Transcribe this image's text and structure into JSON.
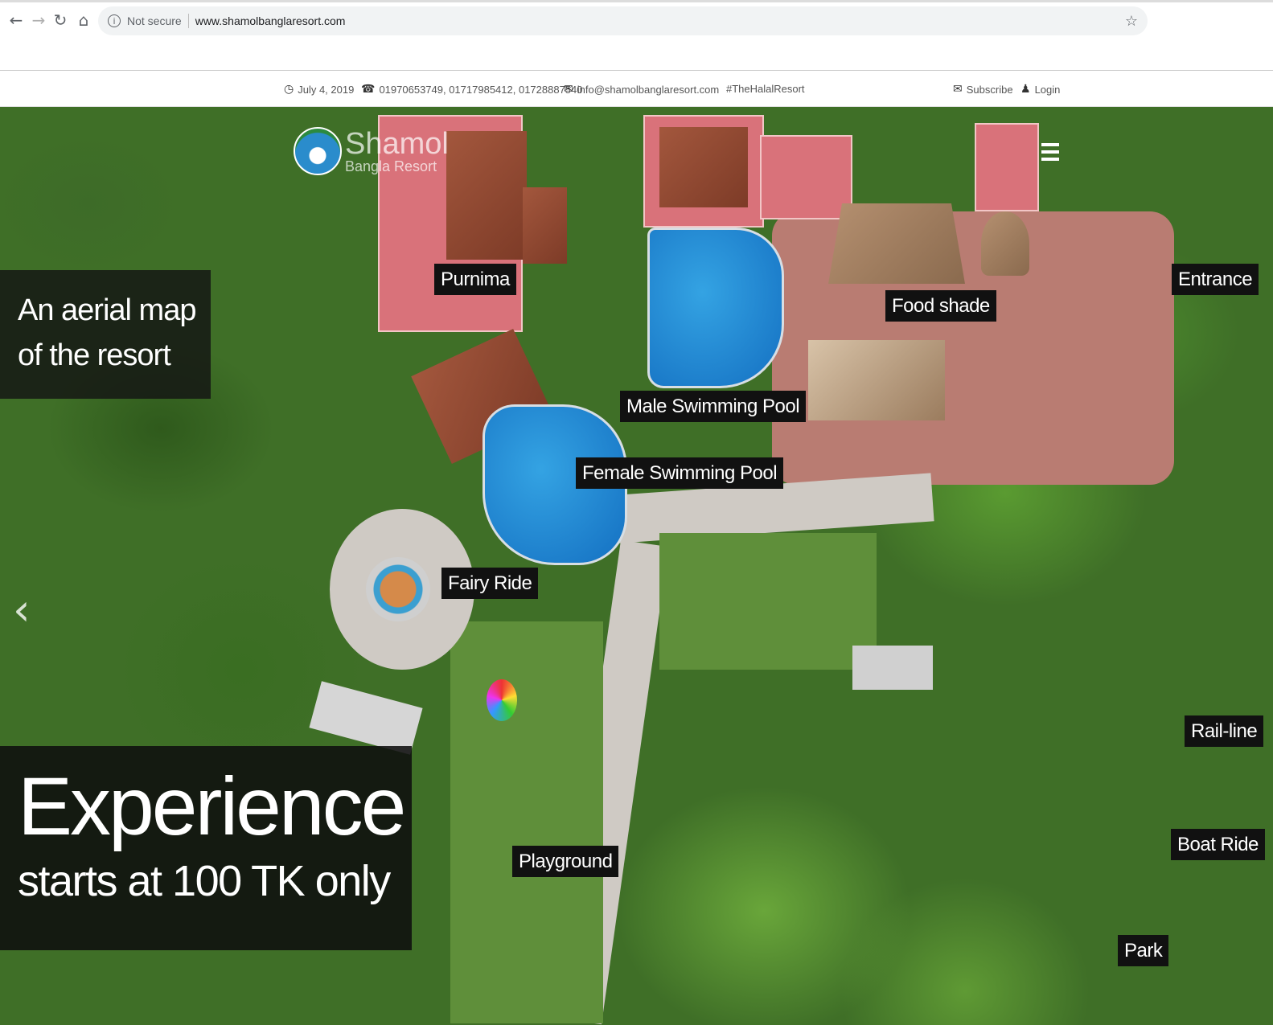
{
  "browser": {
    "security_label": "Not secure",
    "url": "www.shamolbanglaresort.com",
    "icons": [
      "back-arrow-icon",
      "forward-arrow-icon",
      "reload-icon",
      "home-icon",
      "info-icon",
      "star-icon"
    ]
  },
  "infobar": {
    "date": "July 4, 2019",
    "phones": "01970653749, 01717985412, 01728887540",
    "email": "info@shamolbanglaresort.com",
    "hashtag": "#TheHalalResort",
    "subscribe": "Subscribe",
    "login": "Login"
  },
  "logo": {
    "line1": "Shamol",
    "line2": "Bangla Resort"
  },
  "hero": {
    "caption_top_line1": "An aerial map",
    "caption_top_line2": "of the resort",
    "caption_big": "Experience",
    "caption_small": "starts at 100 TK only",
    "labels": {
      "purnima": "Purnima",
      "food_shade": "Food shade",
      "entrance": "Entrance",
      "male_pool": "Male Swimming Pool",
      "female_pool": "Female Swimming Pool",
      "fairy_ride": "Fairy Ride",
      "playground": "Playground",
      "rail_line": "Rail-line",
      "boat_ride": "Boat Ride",
      "park": "Park"
    }
  }
}
